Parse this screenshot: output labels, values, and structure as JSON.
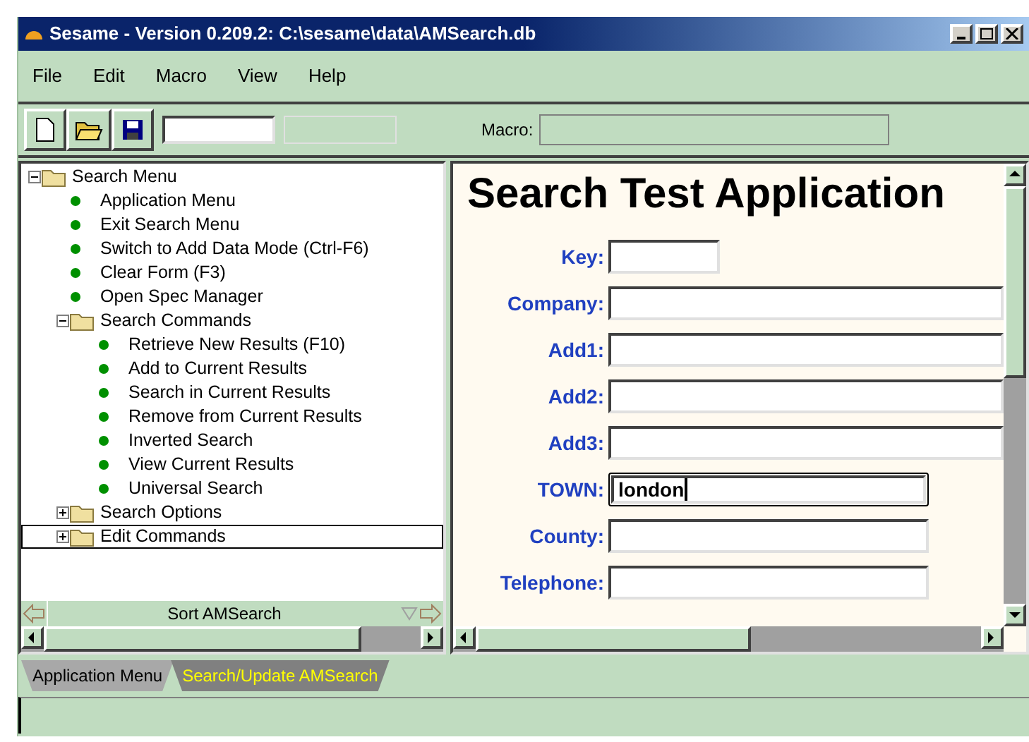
{
  "window": {
    "title": "Sesame - Version 0.209.2: C:\\sesame\\data\\AMSearch.db"
  },
  "menu": [
    "File",
    "Edit",
    "Macro",
    "View",
    "Help"
  ],
  "toolbar": {
    "macro_label": "Macro:"
  },
  "tree": [
    {
      "label": "Search Menu",
      "kind": "folder",
      "expanded": true,
      "selected": false,
      "children": [
        {
          "label": "Application Menu",
          "kind": "command",
          "selected": false
        },
        {
          "label": "Exit Search Menu",
          "kind": "command",
          "selected": false
        },
        {
          "label": "Switch to Add Data Mode (Ctrl-F6)",
          "kind": "command",
          "selected": false
        },
        {
          "label": "Clear Form (F3)",
          "kind": "command",
          "selected": false
        },
        {
          "label": "Open Spec Manager",
          "kind": "command",
          "selected": false
        },
        {
          "label": "Search Commands",
          "kind": "folder",
          "expanded": true,
          "selected": false,
          "children": [
            {
              "label": "Retrieve New Results (F10)",
              "kind": "command",
              "selected": false
            },
            {
              "label": "Add to Current Results",
              "kind": "command",
              "selected": false
            },
            {
              "label": "Search in Current Results",
              "kind": "command",
              "selected": false
            },
            {
              "label": "Remove from Current Results",
              "kind": "command",
              "selected": false
            },
            {
              "label": "Inverted Search",
              "kind": "command",
              "selected": false
            },
            {
              "label": "View Current Results",
              "kind": "command",
              "selected": false
            },
            {
              "label": "Universal Search",
              "kind": "command",
              "selected": false
            }
          ]
        },
        {
          "label": "Search Options",
          "kind": "folder",
          "expanded": false,
          "selected": false
        },
        {
          "label": "Edit Commands",
          "kind": "folder",
          "expanded": false,
          "selected": true
        }
      ]
    }
  ],
  "tree_footer": {
    "label": "Sort AMSearch"
  },
  "form": {
    "title": "Search Test Application",
    "fields": [
      {
        "label": "Key:",
        "kind": "short",
        "focused": false
      },
      {
        "label": "Company:",
        "kind": "long",
        "focused": false
      },
      {
        "label": "Add1:",
        "kind": "long",
        "focused": false
      },
      {
        "label": "Add2:",
        "kind": "long",
        "focused": false
      },
      {
        "label": "Add3:",
        "kind": "long",
        "focused": false
      },
      {
        "label": "TOWN:",
        "kind": "medium",
        "focused": true,
        "value": "london"
      },
      {
        "label": "County:",
        "kind": "medium",
        "focused": false
      },
      {
        "label": "Telephone:",
        "kind": "medium",
        "focused": false
      }
    ]
  },
  "tabs": [
    {
      "label": "Application Menu",
      "selected": false
    },
    {
      "label": "Search/Update AMSearch",
      "selected": true
    }
  ]
}
